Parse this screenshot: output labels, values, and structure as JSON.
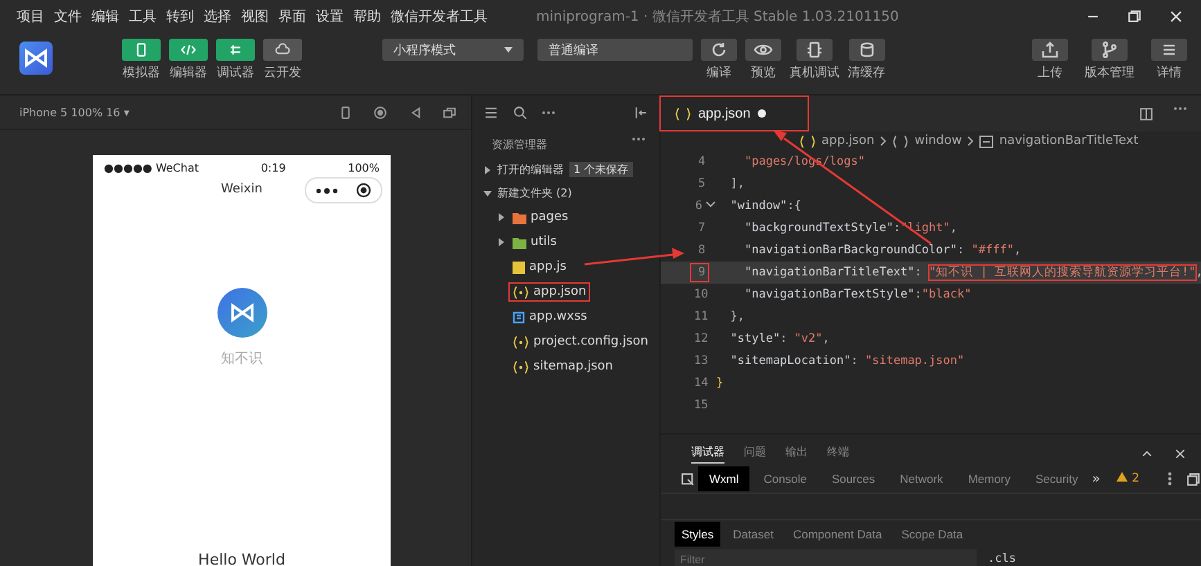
{
  "menu": [
    "项目",
    "文件",
    "编辑",
    "工具",
    "转到",
    "选择",
    "视图",
    "界面",
    "设置",
    "帮助",
    "微信开发者工具"
  ],
  "window": {
    "title": "miniprogram-1 · 微信开发者工具 Stable 1.03.2101150"
  },
  "toolbar": {
    "view_toggles": [
      {
        "label": "模拟器",
        "kind": "phone",
        "on": true
      },
      {
        "label": "编辑器",
        "kind": "code",
        "on": true
      },
      {
        "label": "调试器",
        "kind": "debug",
        "on": true
      },
      {
        "label": "云开发",
        "kind": "cloud",
        "on": false
      }
    ],
    "mode_select": "小程序模式",
    "compile_select": "普通编译",
    "actions": [
      {
        "label": "编译",
        "kind": "refresh"
      },
      {
        "label": "预览",
        "kind": "eye"
      },
      {
        "label": "真机调试",
        "kind": "device"
      },
      {
        "label": "清缓存",
        "kind": "stack"
      }
    ],
    "right_actions": [
      {
        "label": "上传",
        "kind": "upload"
      },
      {
        "label": "版本管理",
        "kind": "branch"
      },
      {
        "label": "详情",
        "kind": "menu"
      }
    ]
  },
  "simulator": {
    "device": "iPhone 5 100% 16 ▾",
    "status": {
      "carrier": "●●●●● WeChat",
      "time": "0:19",
      "battery": "100%"
    },
    "nav_title": "Weixin",
    "app_name": "知不识",
    "greeting": "Hello World"
  },
  "explorer": {
    "title": "资源管理器",
    "sections": [
      {
        "label": "打开的编辑器",
        "badge": "1 个未保存",
        "expanded": false
      },
      {
        "label": "新建文件夹 (2)",
        "expanded": true,
        "children": [
          {
            "name": "pages",
            "kind": "folder",
            "color": "#e8743b",
            "expanded": false,
            "annotated": false
          },
          {
            "name": "utils",
            "kind": "folder",
            "color": "#7cb342",
            "expanded": false,
            "annotated": false
          },
          {
            "name": "app.js",
            "kind": "js",
            "annotated": false
          },
          {
            "name": "app.json",
            "kind": "json",
            "annotated": true
          },
          {
            "name": "app.wxss",
            "kind": "wxss",
            "annotated": false
          },
          {
            "name": "project.config.json",
            "kind": "json",
            "annotated": false
          },
          {
            "name": "sitemap.json",
            "kind": "json",
            "annotated": false
          }
        ]
      }
    ]
  },
  "editor": {
    "tab": {
      "name": "app.json",
      "unsaved": true,
      "annotated": true
    },
    "breadcrumb": [
      {
        "label": "app.json",
        "kind": "json"
      },
      {
        "label": "window",
        "kind": "object"
      },
      {
        "label": "navigationBarTitleText",
        "kind": "property"
      }
    ],
    "lines": [
      {
        "number": "4",
        "fold": false,
        "current": false,
        "annotated": false,
        "tokens": [
          {
            "kind": "value",
            "text": "    \"pages/logs/logs\""
          }
        ]
      },
      {
        "number": "5",
        "fold": false,
        "current": false,
        "annotated": false,
        "tokens": [
          {
            "kind": "punct",
            "text": "  ],"
          }
        ]
      },
      {
        "number": "6",
        "fold": true,
        "current": false,
        "annotated": false,
        "tokens": [
          {
            "kind": "key",
            "text": "  \"window\""
          },
          {
            "kind": "punct",
            "text": ":{"
          }
        ]
      },
      {
        "number": "7",
        "fold": false,
        "current": false,
        "annotated": false,
        "tokens": [
          {
            "kind": "key",
            "text": "    \"backgroundTextStyle\""
          },
          {
            "kind": "punct",
            "text": ":"
          },
          {
            "kind": "value",
            "text": "\"light\""
          },
          {
            "kind": "punct",
            "text": ","
          }
        ]
      },
      {
        "number": "8",
        "fold": false,
        "current": false,
        "annotated": false,
        "tokens": [
          {
            "kind": "key",
            "text": "    \"navigationBarBackgroundColor\""
          },
          {
            "kind": "punct",
            "text": ": "
          },
          {
            "kind": "value",
            "text": "\"#fff\""
          },
          {
            "kind": "punct",
            "text": ","
          }
        ]
      },
      {
        "number": "9",
        "fold": false,
        "current": true,
        "annotated": true,
        "tokens": [
          {
            "kind": "key",
            "text": "    \"navigationBarTitleText\""
          },
          {
            "kind": "punct",
            "text": ": "
          },
          {
            "kind": "value",
            "text": "\"知不识 | 互联网人的搜索导航资源学习平台!\""
          },
          {
            "kind": "punct",
            "text": ","
          }
        ]
      },
      {
        "number": "10",
        "fold": false,
        "current": false,
        "annotated": false,
        "tokens": [
          {
            "kind": "key",
            "text": "    \"navigationBarTextStyle\""
          },
          {
            "kind": "punct",
            "text": ":"
          },
          {
            "kind": "value",
            "text": "\"black\""
          }
        ]
      },
      {
        "number": "11",
        "fold": false,
        "current": false,
        "annotated": false,
        "tokens": [
          {
            "kind": "punct",
            "text": "  },"
          }
        ]
      },
      {
        "number": "12",
        "fold": false,
        "current": false,
        "annotated": false,
        "tokens": [
          {
            "kind": "key",
            "text": "  \"style\""
          },
          {
            "kind": "punct",
            "text": ": "
          },
          {
            "kind": "value",
            "text": "\"v2\""
          },
          {
            "kind": "punct",
            "text": ","
          }
        ]
      },
      {
        "number": "13",
        "fold": false,
        "current": false,
        "annotated": false,
        "tokens": [
          {
            "kind": "key",
            "text": "  \"sitemapLocation\""
          },
          {
            "kind": "punct",
            "text": ": "
          },
          {
            "kind": "value",
            "text": "\"sitemap.json\""
          }
        ]
      },
      {
        "number": "14",
        "fold": false,
        "current": false,
        "annotated": false,
        "tokens": [
          {
            "kind": "brace",
            "text": "}"
          }
        ]
      },
      {
        "number": "15",
        "fold": false,
        "current": false,
        "annotated": false
      }
    ]
  },
  "debugger": {
    "panel_tabs": [
      {
        "label": "调试器",
        "selected": true
      },
      {
        "label": "问题",
        "selected": false
      },
      {
        "label": "输出",
        "selected": false
      },
      {
        "label": "终端",
        "selected": false
      }
    ],
    "devtools_tabs": [
      {
        "label": "Wxml",
        "selected": true
      },
      {
        "label": "Console",
        "selected": false
      },
      {
        "label": "Sources",
        "selected": false
      },
      {
        "label": "Network",
        "selected": false
      },
      {
        "label": "Memory",
        "selected": false
      },
      {
        "label": "Security",
        "selected": false
      }
    ],
    "overflow": "»",
    "warnings": "2",
    "style_tabs": [
      {
        "label": "Styles",
        "selected": true
      },
      {
        "label": "Dataset",
        "selected": false
      },
      {
        "label": "Component Data",
        "selected": false
      },
      {
        "label": "Scope Data",
        "selected": false
      }
    ],
    "filter_placeholder": "Filter",
    "cls": ".cls"
  }
}
